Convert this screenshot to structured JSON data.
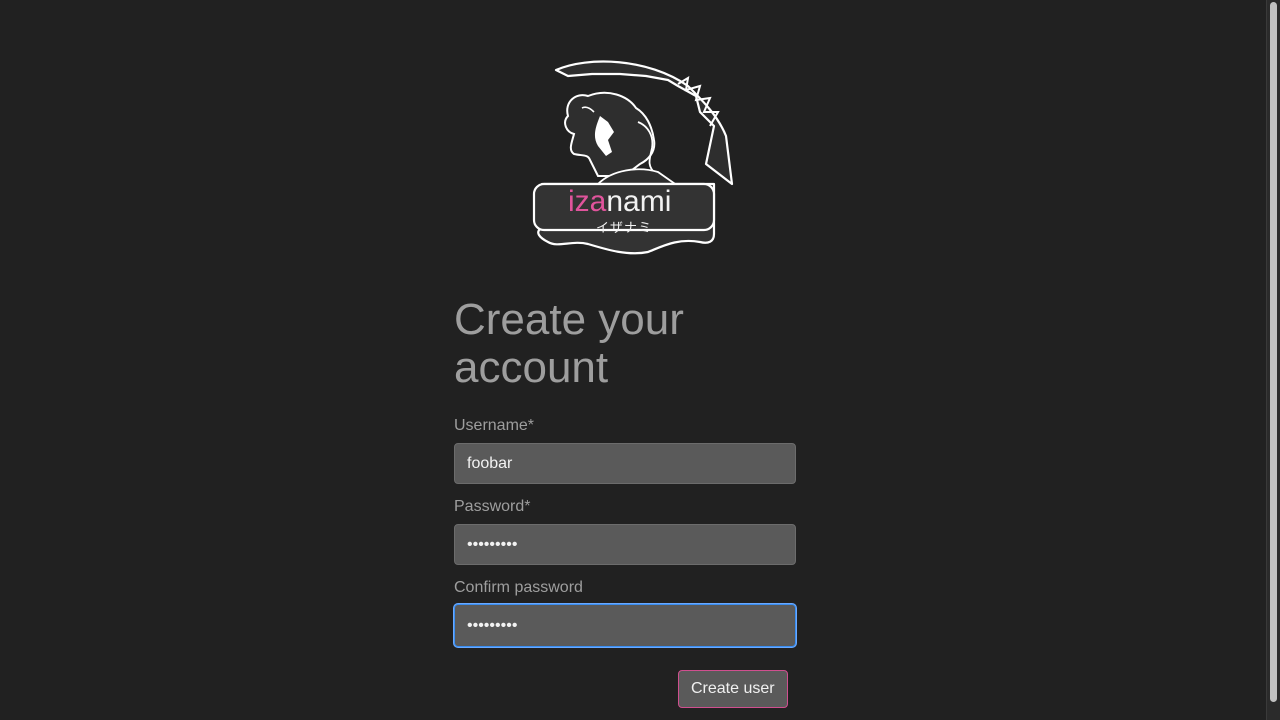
{
  "logo": {
    "wordmark_accent": "iza",
    "wordmark_rest": "nami",
    "kana": "イザナミ",
    "accent_color": "#e0549c"
  },
  "form": {
    "title": "Create your account",
    "username_label": "Username*",
    "username_value": "foobar",
    "password_label": "Password*",
    "password_value": "•••••••••",
    "confirm_label": "Confirm password",
    "confirm_value": "•••••••••",
    "submit_label": "Create user"
  },
  "colors": {
    "background": "#212121",
    "field_background": "#5a5a5a",
    "focus_ring": "#3b8ef0",
    "button_border": "#d04f8f"
  }
}
